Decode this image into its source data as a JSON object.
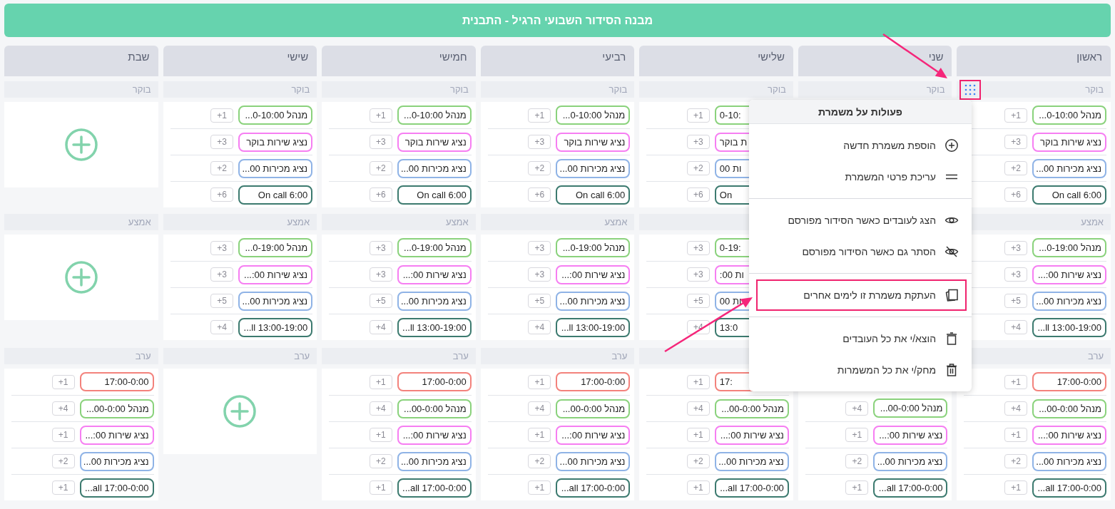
{
  "title": "מבנה הסידור השבועי הרגיל - התבנית",
  "days": [
    {
      "name": "ראשון",
      "sections": [
        {
          "label": "בוקר",
          "kind": "rows",
          "handle": {
            "annotated": true
          },
          "rows": [
            {
              "text": "מנהל 0-10:00...",
              "color": "#8ad27c",
              "count": "+1"
            },
            {
              "text": "נציג שירות בוקר",
              "color": "#f67ef2",
              "count": "+3"
            },
            {
              "text": "נציג מכירות 00...",
              "color": "#8fb3e6",
              "count": "+2"
            },
            {
              "text": "On call 6:00",
              "color": "#3c7a6f",
              "count": "+6"
            }
          ]
        },
        {
          "label": "אמצע",
          "kind": "rows",
          "rows": [
            {
              "text": "מנהל 0-19:00...",
              "color": "#8ad27c",
              "count": "+3"
            },
            {
              "text": "נציג שירות 00:...",
              "color": "#f67ef2",
              "count": "+3"
            },
            {
              "text": "נציג מכירות 00...",
              "color": "#8fb3e6",
              "count": "+5"
            },
            {
              "text": "...ll 13:00-19:00",
              "color": "#3c7a6f",
              "count": "+4"
            }
          ]
        },
        {
          "label": "ערב",
          "kind": "rows",
          "rows": [
            {
              "text": "17:00-0:00",
              "color": "#f3827c",
              "count": "+1"
            },
            {
              "text": "מנהל 00-0:00...",
              "color": "#8ad27c",
              "count": "+4"
            },
            {
              "text": "נציג שירות 00:...",
              "color": "#f67ef2",
              "count": "+1"
            },
            {
              "text": "נציג מכירות 00...",
              "color": "#8fb3e6",
              "count": "+2"
            },
            {
              "text": "...all 17:00-0:00",
              "color": "#3c7a6f",
              "count": "+1"
            }
          ]
        }
      ]
    },
    {
      "name": "שני",
      "sections": [
        {
          "label": "בוקר",
          "kind": "rows"
        },
        {
          "kind": "covered"
        },
        {
          "kind": "rows",
          "covered": true,
          "rows": [
            {
              "text": "מנהל 00-0:00...",
              "color": "#8ad27c",
              "count": "+4"
            },
            {
              "text": "נציג שירות 00:...",
              "color": "#f67ef2",
              "count": "+1"
            },
            {
              "text": "נציג מכירות 00...",
              "color": "#8fb3e6",
              "count": "+2"
            },
            {
              "text": "...all 17:00-0:00",
              "color": "#3c7a6f",
              "count": "+1"
            }
          ]
        }
      ]
    },
    {
      "name": "שלישי",
      "sections": [
        {
          "label": "בוקר",
          "kind": "rows",
          "rows": [
            {
              "text": "0-10:",
              "color": "#8ad27c",
              "count": "+1",
              "clipped": true
            },
            {
              "text": "ת בוקר",
              "color": "#f67ef2",
              "count": "+3",
              "clipped": true
            },
            {
              "text": "ות 00",
              "color": "#8fb3e6",
              "count": "+2",
              "clipped": true
            },
            {
              "text": "On",
              "color": "#3c7a6f",
              "count": "+6",
              "clipped": true
            }
          ]
        },
        {
          "kind": "rows",
          "rows": [
            {
              "text": "0-19:",
              "color": "#8ad27c",
              "count": "+3",
              "clipped": true
            },
            {
              "text": "ות 00:",
              "color": "#f67ef2",
              "count": "+3",
              "clipped": true
            },
            {
              "text": "ות 00",
              "color": "#8fb3e6",
              "count": "+5",
              "clipped": true
            },
            {
              "text": "13:0",
              "color": "#3c7a6f",
              "count": "+4",
              "clipped": true
            }
          ]
        },
        {
          "kind": "rows",
          "rows": [
            {
              "text": "17:",
              "color": "#f3827c",
              "count": "+1",
              "clipped": true
            },
            {
              "text": "מנהל 00-0:00...",
              "color": "#8ad27c",
              "count": "+4"
            },
            {
              "text": "נציג שירות 00:...",
              "color": "#f67ef2",
              "count": "+1"
            },
            {
              "text": "נציג מכירות 00...",
              "color": "#8fb3e6",
              "count": "+2"
            },
            {
              "text": "...all 17:00-0:00",
              "color": "#3c7a6f",
              "count": "+1"
            }
          ]
        }
      ]
    },
    {
      "name": "רביעי",
      "sections": [
        {
          "label": "בוקר",
          "kind": "rows",
          "rows": [
            {
              "text": "מנהל 0-10:00...",
              "color": "#8ad27c",
              "count": "+1"
            },
            {
              "text": "נציג שירות בוקר",
              "color": "#f67ef2",
              "count": "+3"
            },
            {
              "text": "נציג מכירות 00...",
              "color": "#8fb3e6",
              "count": "+2"
            },
            {
              "text": "On call 6:00",
              "color": "#3c7a6f",
              "count": "+6"
            }
          ]
        },
        {
          "label": "אמצע",
          "kind": "rows",
          "rows": [
            {
              "text": "מנהל 0-19:00...",
              "color": "#8ad27c",
              "count": "+3"
            },
            {
              "text": "נציג שירות 00:...",
              "color": "#f67ef2",
              "count": "+3"
            },
            {
              "text": "נציג מכירות 00...",
              "color": "#8fb3e6",
              "count": "+5"
            },
            {
              "text": "...ll 13:00-19:00",
              "color": "#3c7a6f",
              "count": "+4"
            }
          ]
        },
        {
          "label": "ערב",
          "kind": "rows",
          "rows": [
            {
              "text": "17:00-0:00",
              "color": "#f3827c",
              "count": "+1"
            },
            {
              "text": "מנהל 00-0:00...",
              "color": "#8ad27c",
              "count": "+4"
            },
            {
              "text": "נציג שירות 00:...",
              "color": "#f67ef2",
              "count": "+1"
            },
            {
              "text": "נציג מכירות 00...",
              "color": "#8fb3e6",
              "count": "+2"
            },
            {
              "text": "...all 17:00-0:00",
              "color": "#3c7a6f",
              "count": "+1"
            }
          ]
        }
      ]
    },
    {
      "name": "חמישי",
      "sections": [
        {
          "label": "בוקר",
          "kind": "rows",
          "rows": [
            {
              "text": "מנהל 0-10:00...",
              "color": "#8ad27c",
              "count": "+1"
            },
            {
              "text": "נציג שירות בוקר",
              "color": "#f67ef2",
              "count": "+3"
            },
            {
              "text": "נציג מכירות 00...",
              "color": "#8fb3e6",
              "count": "+2"
            },
            {
              "text": "On call 6:00",
              "color": "#3c7a6f",
              "count": "+6"
            }
          ]
        },
        {
          "label": "אמצע",
          "kind": "rows",
          "rows": [
            {
              "text": "מנהל 0-19:00...",
              "color": "#8ad27c",
              "count": "+3"
            },
            {
              "text": "נציג שירות 00:...",
              "color": "#f67ef2",
              "count": "+3"
            },
            {
              "text": "נציג מכירות 00...",
              "color": "#8fb3e6",
              "count": "+5"
            },
            {
              "text": "...ll 13:00-19:00",
              "color": "#3c7a6f",
              "count": "+4"
            }
          ]
        },
        {
          "label": "ערב",
          "kind": "rows",
          "rows": [
            {
              "text": "17:00-0:00",
              "color": "#f3827c",
              "count": "+1"
            },
            {
              "text": "מנהל 00-0:00...",
              "color": "#8ad27c",
              "count": "+4"
            },
            {
              "text": "נציג שירות 00:...",
              "color": "#f67ef2",
              "count": "+1"
            },
            {
              "text": "נציג מכירות 00...",
              "color": "#8fb3e6",
              "count": "+2"
            },
            {
              "text": "...all 17:00-0:00",
              "color": "#3c7a6f",
              "count": "+1"
            }
          ]
        }
      ]
    },
    {
      "name": "שישי",
      "sections": [
        {
          "label": "בוקר",
          "kind": "rows",
          "rows": [
            {
              "text": "מנהל 0-10:00...",
              "color": "#8ad27c",
              "count": "+1"
            },
            {
              "text": "נציג שירות בוקר",
              "color": "#f67ef2",
              "count": "+3"
            },
            {
              "text": "נציג מכירות 00...",
              "color": "#8fb3e6",
              "count": "+2"
            },
            {
              "text": "On call 6:00",
              "color": "#3c7a6f",
              "count": "+6"
            }
          ]
        },
        {
          "label": "אמצע",
          "kind": "rows",
          "rows": [
            {
              "text": "מנהל 0-19:00...",
              "color": "#8ad27c",
              "count": "+3"
            },
            {
              "text": "נציג שירות 00:...",
              "color": "#f67ef2",
              "count": "+3"
            },
            {
              "text": "נציג מכירות 00...",
              "color": "#8fb3e6",
              "count": "+5"
            },
            {
              "text": "...ll 13:00-19:00",
              "color": "#3c7a6f",
              "count": "+4"
            }
          ]
        },
        {
          "label": "ערב",
          "kind": "empty"
        }
      ]
    },
    {
      "name": "שבת",
      "sections": [
        {
          "label": "בוקר",
          "kind": "empty"
        },
        {
          "label": "אמצע",
          "kind": "empty"
        },
        {
          "label": "ערב",
          "kind": "rows",
          "rows": [
            {
              "text": "17:00-0:00",
              "color": "#f3827c",
              "count": "+1"
            },
            {
              "text": "מנהל 00-0:00...",
              "color": "#8ad27c",
              "count": "+4"
            },
            {
              "text": "נציג שירות 00:...",
              "color": "#f67ef2",
              "count": "+1"
            },
            {
              "text": "נציג מכירות 00...",
              "color": "#8fb3e6",
              "count": "+2"
            },
            {
              "text": "...all 17:00-0:00",
              "color": "#3c7a6f",
              "count": "+1"
            }
          ]
        }
      ]
    }
  ],
  "menu": {
    "title": "פעולות על משמרת",
    "groups": [
      [
        {
          "kind": "add",
          "label": "הוספת משמרת חדשה",
          "annotated": false
        },
        {
          "kind": "edit",
          "label": "עריכת פרטי המשמרת",
          "annotated": false
        }
      ],
      [
        {
          "kind": "show",
          "label": "הצג לעובדים כאשר הסידור מפורסם",
          "annotated": false
        },
        {
          "kind": "hide",
          "label": "הסתר גם כאשר הסידור מפורסם",
          "annotated": false
        }
      ],
      [
        {
          "kind": "copy",
          "label": "העתקת משמרת זו לימים אחרים",
          "annotated": true
        }
      ],
      [
        {
          "kind": "remove",
          "label": "הוצא/י את כל העובדים",
          "annotated": false
        },
        {
          "kind": "delete",
          "label": "מחק/י את כל המשמרות",
          "annotated": false
        }
      ]
    ]
  }
}
